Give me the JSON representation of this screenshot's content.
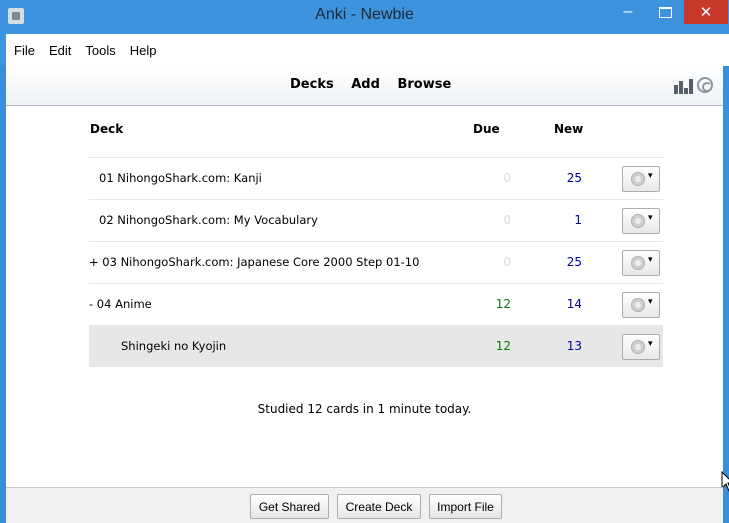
{
  "window": {
    "title": "Anki - Newbie",
    "minimize": "–",
    "close": "✕"
  },
  "menu": [
    "File",
    "Edit",
    "Tools",
    "Help"
  ],
  "toolbar": {
    "decks": "Decks",
    "add": "Add",
    "browse": "Browse"
  },
  "table": {
    "headers": {
      "deck": "Deck",
      "due": "Due",
      "new": "New"
    },
    "rows": [
      {
        "name": "01 NihongoShark.com: Kanji",
        "due": "0",
        "new": "25"
      },
      {
        "name": "02 NihongoShark.com: My Vocabulary",
        "due": "0",
        "new": "1"
      },
      {
        "name": "+ 03 NihongoShark.com: Japanese Core 2000 Step 01-10",
        "due": "0",
        "new": "25"
      },
      {
        "name": "-  04 Anime",
        "due": "12",
        "new": "14"
      },
      {
        "name": "Shingeki no Kyojin",
        "due": "12",
        "new": "13"
      }
    ],
    "gear_arrow": "▾"
  },
  "studied": "Studied 12 cards in 1 minute today.",
  "buttons": {
    "get_shared": "Get Shared",
    "create_deck": "Create Deck",
    "import_file": "Import File"
  },
  "colors": {
    "titlebar": "#3d93dc",
    "close": "#c8392c",
    "due_green": "#0a7a0a",
    "new_blue": "#00009a",
    "due_zero": "#dddddd"
  },
  "icons": [
    "app-icon",
    "stats-icon",
    "sync-icon",
    "gear-icon",
    "mouse-cursor-icon"
  ]
}
